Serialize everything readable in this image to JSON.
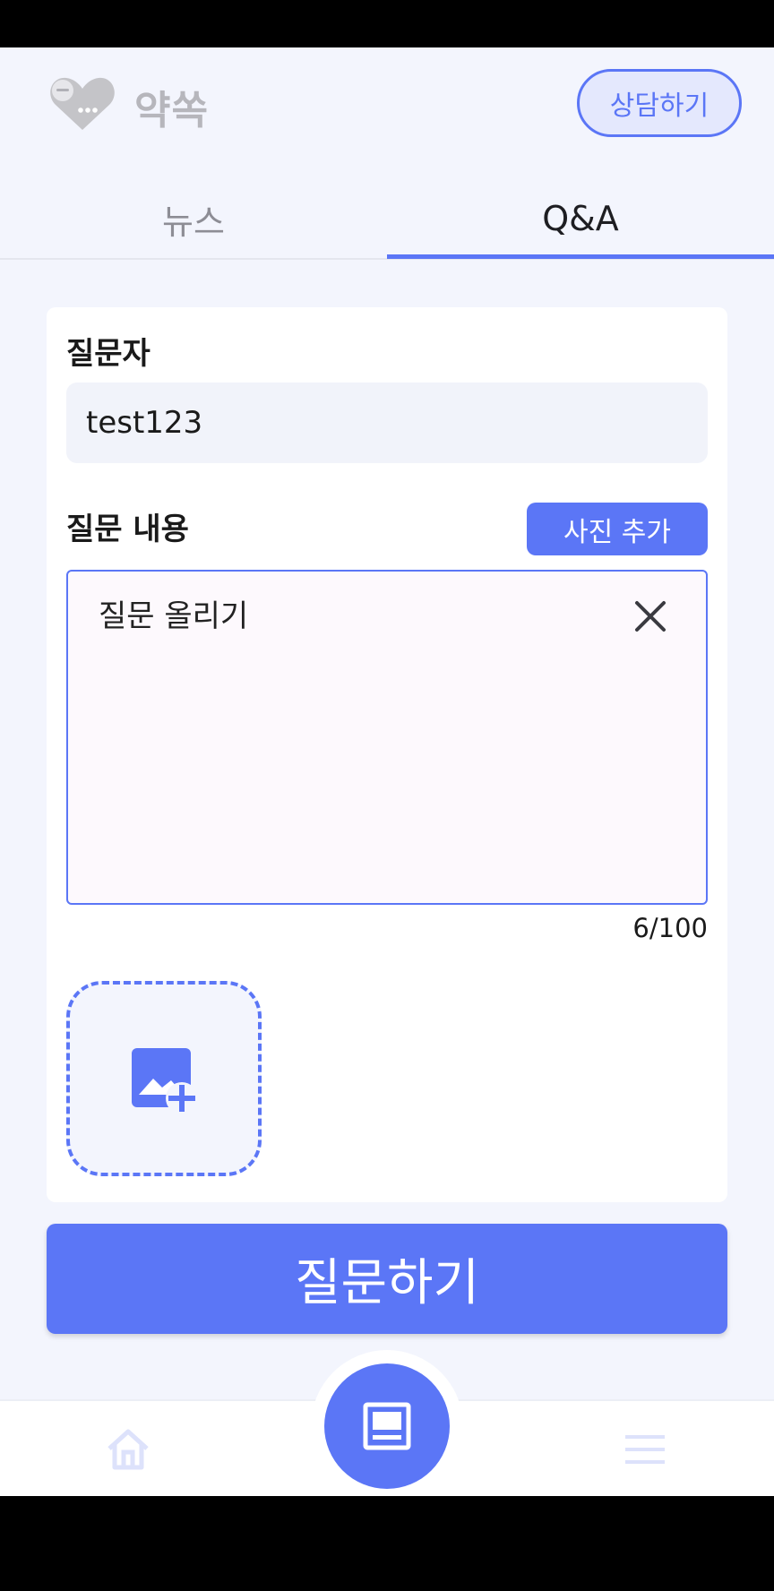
{
  "header": {
    "app_name": "약쏙",
    "consult_label": "상담하기"
  },
  "tabs": [
    {
      "label": "뉴스",
      "active": false
    },
    {
      "label": "Q&A",
      "active": true
    }
  ],
  "form": {
    "asker_label": "질문자",
    "asker_value": "test123",
    "content_label": "질문 내용",
    "add_photo_label": "사진 추가",
    "content_value": "질문 올리기",
    "counter": "6/100",
    "submit_label": "질문하기"
  },
  "bottom_nav": {
    "items": [
      {
        "icon": "home-icon"
      },
      {
        "icon": "article-icon"
      },
      {
        "icon": "menu-icon"
      }
    ]
  },
  "colors": {
    "accent": "#5b76f6",
    "background": "#f3f5fd"
  }
}
